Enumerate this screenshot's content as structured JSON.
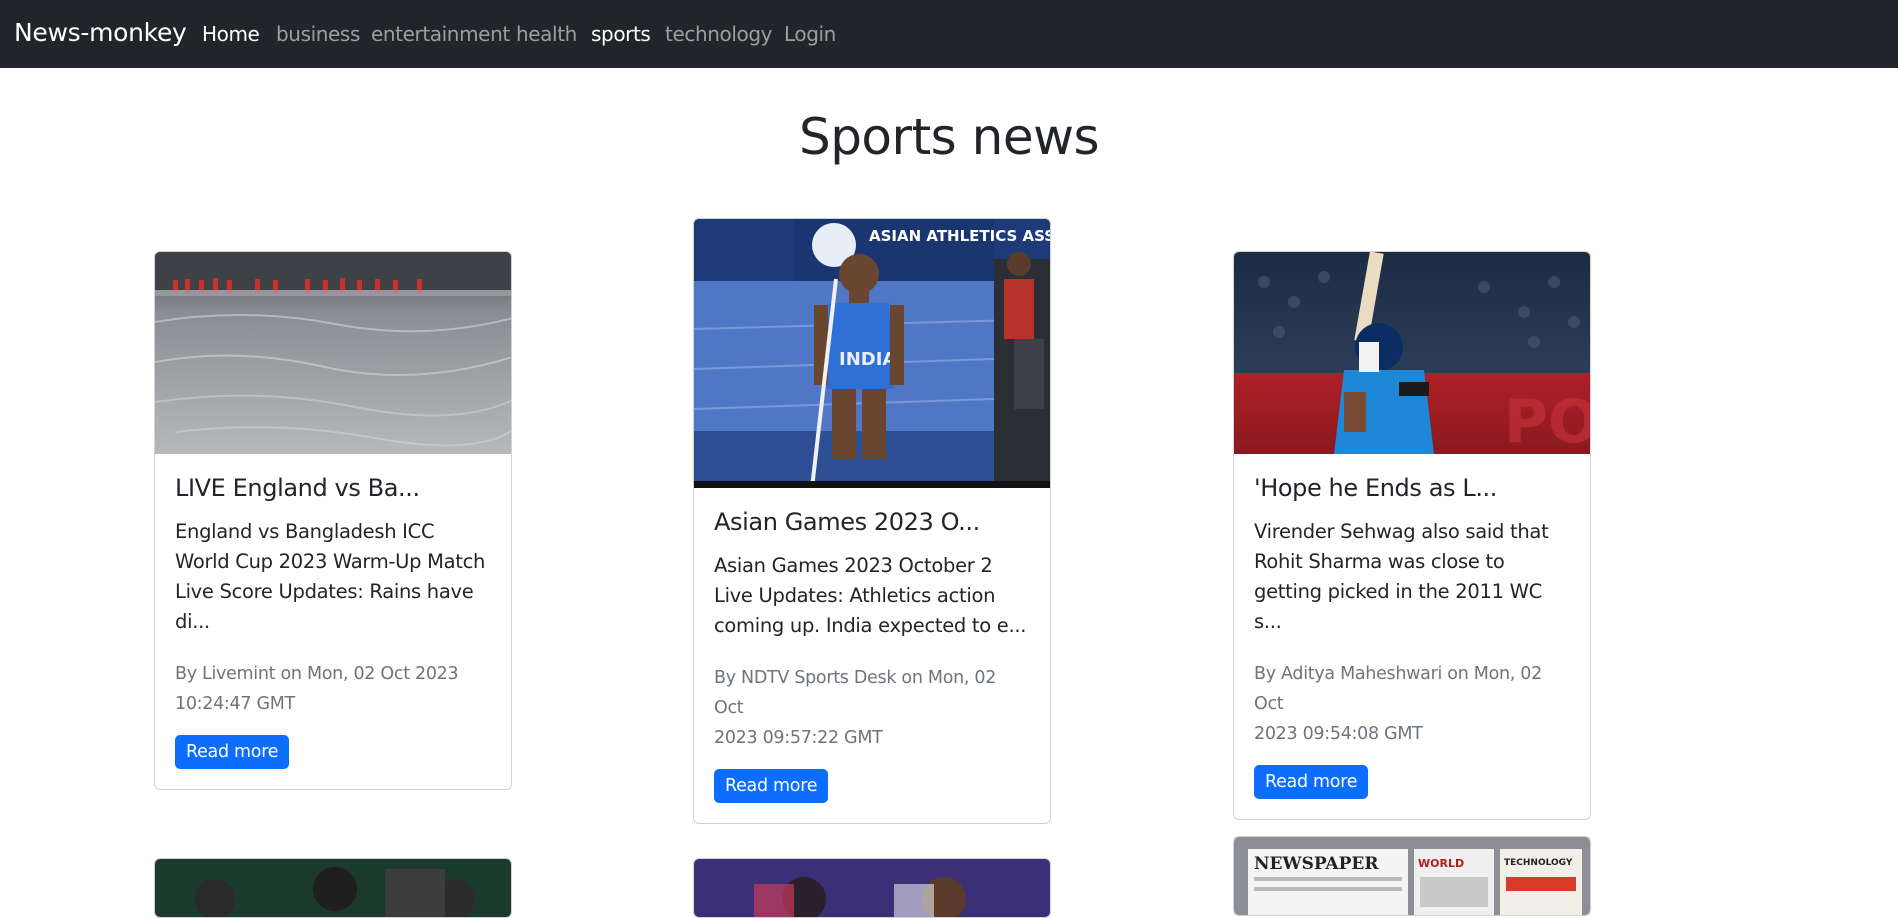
{
  "navbar": {
    "brand": "News-monkey",
    "links": [
      "Home",
      "business",
      "entertainment",
      "health",
      "sports",
      "technology",
      "Login"
    ]
  },
  "page": {
    "title": "Sports news"
  },
  "cards": [
    {
      "title": "LIVE England vs Ba...",
      "description": "England vs Bangladesh ICC World Cup 2023 Warm-Up Match Live Score Updates: Rains have di...",
      "meta_line1": "By Livemint on Mon, 02 Oct 2023",
      "meta_line2": "10:24:47 GMT",
      "button": "Read more",
      "image": "rain-covered-cricket-field"
    },
    {
      "title": "Asian Games 2023 O...",
      "description": "Asian Games 2023 October 2 Live Updates: Athletics action coming up. India expected to e...",
      "meta_line1": "By NDTV Sports Desk on Mon, 02 Oct",
      "meta_line2": "2023 09:57:22 GMT",
      "button": "Read more",
      "image": "athlete-pole-vault",
      "image_banner": "ASIAN ATHLETICS ASSOCIATION",
      "image_jersey": "INDIA"
    },
    {
      "title": "'Hope he Ends as L...",
      "description": "Virender Sehwag also said that Rohit Sharma was close to getting picked in the 2011 WC s...",
      "meta_line1": "By Aditya Maheshwari on Mon, 02 Oct",
      "meta_line2": "2023 09:54:08 GMT",
      "button": "Read more",
      "image": "cricketer-batting"
    }
  ],
  "row2_images": [
    "badminton-players",
    "athletes-group",
    "newspaper-stack"
  ],
  "newspaper_words": [
    "NEWSPAPER",
    "WORLD",
    "TECHNOLOGY"
  ],
  "colors": {
    "navbar": "#212529",
    "primary": "#0d6efd",
    "muted": "#6c757d"
  }
}
